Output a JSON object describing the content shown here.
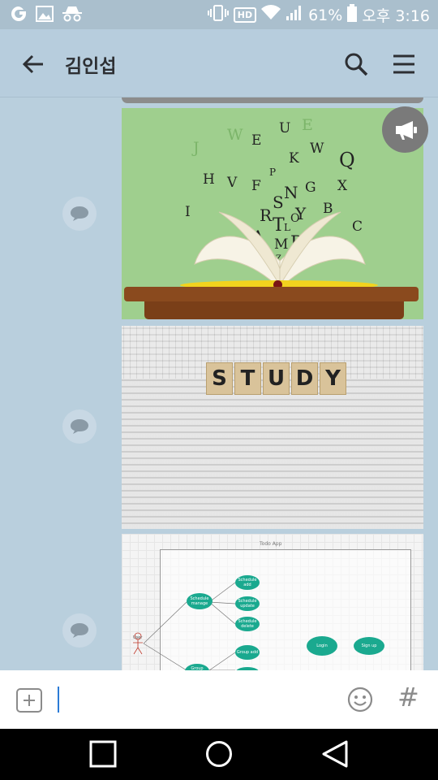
{
  "status_bar": {
    "battery_percent": "61%",
    "time": "오후 3:16",
    "hd_label": "HD",
    "icons": [
      "carrier-icon",
      "gallery-icon",
      "incognito-icon",
      "vibrate-icon",
      "hd-icon",
      "wifi-icon",
      "signal-icon",
      "battery-icon"
    ]
  },
  "header": {
    "title": "김인섭",
    "back_icon": "arrow-left-icon",
    "search_icon": "search-icon",
    "menu_icon": "hamburger-icon"
  },
  "feed": {
    "posts": [
      {
        "kind": "image",
        "description_icon": "book-letters-image",
        "letters": [
          "W",
          "E",
          "U",
          "E",
          "W",
          "K",
          "J",
          "H",
          "P",
          "G",
          "X",
          "V",
          "F",
          "N",
          "S",
          "B",
          "I",
          "A",
          "R",
          "T",
          "Y",
          "L",
          "O",
          "M",
          "D",
          "C",
          "Q",
          "Z"
        ]
      },
      {
        "kind": "image",
        "tiles": [
          "S",
          "T",
          "U",
          "D",
          "Y"
        ]
      },
      {
        "kind": "image",
        "diagram_title": "Todo App",
        "nodes": [
          "Schedule manage",
          "Schedule add",
          "Schedule update",
          "Schedule delete",
          "Group add",
          "Login",
          "Sign up",
          "Group manage"
        ],
        "actor": "User"
      }
    ],
    "comment_icon": "speech-bubble-icon",
    "announce_icon": "megaphone-icon"
  },
  "composer": {
    "value": "",
    "plus_icon": "add-attachment-icon",
    "emoji_icon": "emoji-icon",
    "hashtag": "#"
  },
  "navbar": {
    "icons": [
      "recent-apps-icon",
      "home-icon",
      "back-icon"
    ]
  }
}
